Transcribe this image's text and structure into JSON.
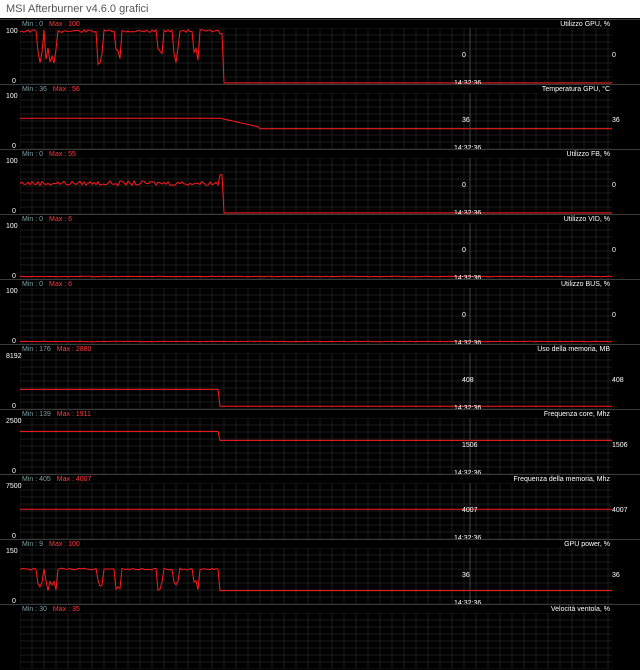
{
  "window": {
    "title": "MSI Afterburner v4.6.0 grafici"
  },
  "graphs": [
    {
      "title": "Utilizzo GPU, %",
      "min": "Min : 0",
      "max": "Max : 100",
      "scale_max": "100",
      "scale_min": "0",
      "time": "14:32:36",
      "current": "0",
      "kind": "usage"
    },
    {
      "title": "Temperatura GPU, °C",
      "min": "Min : 36",
      "max": "Max : 56",
      "scale_max": "100",
      "scale_min": "0",
      "time": "14:32:36",
      "current": "36",
      "kind": "temp"
    },
    {
      "title": "Utilizzo FB, %",
      "min": "Min : 0",
      "max": "Max : 55",
      "scale_max": "100",
      "scale_min": "0",
      "time": "14:32:36",
      "current": "0",
      "kind": "fb"
    },
    {
      "title": "Utilizzo VID, %",
      "min": "Min : 0",
      "max": "Max : 6",
      "scale_max": "100",
      "scale_min": "0",
      "time": "14:32:36",
      "current": "0",
      "kind": "vid"
    },
    {
      "title": "Utilizzo BUS, %",
      "min": "Min : 0",
      "max": "Max : 6",
      "scale_max": "100",
      "scale_min": "0",
      "time": "14:32:36",
      "current": "0",
      "kind": "bus"
    },
    {
      "title": "Uso della memoria, MB",
      "min": "Min : 176",
      "max": "Max : 2880",
      "scale_max": "8192",
      "scale_min": "0",
      "time": "14:32:36",
      "current": "408",
      "kind": "mem"
    },
    {
      "title": "Frequenza core, Mhz",
      "min": "Min : 139",
      "max": "Max : 1911",
      "scale_max": "2500",
      "scale_min": "0",
      "time": "14:32:36",
      "current": "1506",
      "kind": "core"
    },
    {
      "title": "Frequenza della memoria, Mhz",
      "min": "Min : 405",
      "max": "Max : 4007",
      "scale_max": "7500",
      "scale_min": "0",
      "time": "14:32:36",
      "current": "4007",
      "kind": "memclk"
    },
    {
      "title": "GPU power, %",
      "min": "Min : 9",
      "max": "Max : 100",
      "scale_max": "150",
      "scale_min": "0",
      "time": "14:32:36",
      "current": "36",
      "kind": "power"
    },
    {
      "title": "Velocità ventola, %",
      "min": "Min : 30",
      "max": "Max : 35",
      "scale_max": "",
      "scale_min": "",
      "time": "",
      "current": "",
      "kind": "fan"
    }
  ]
}
